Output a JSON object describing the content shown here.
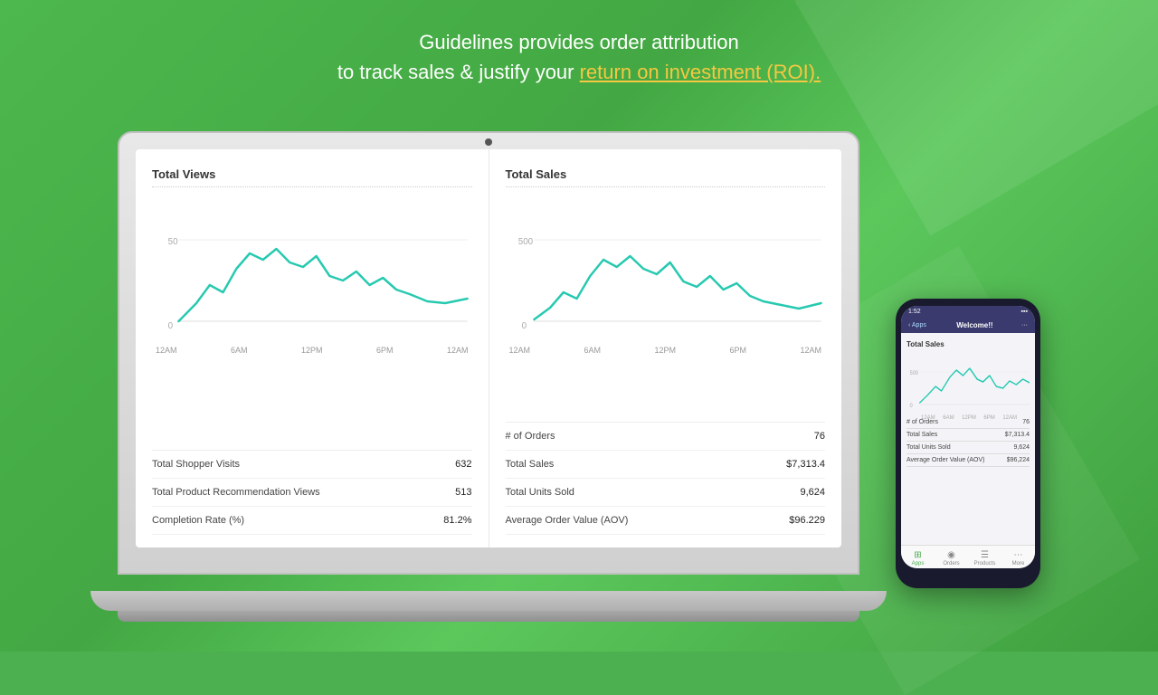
{
  "header": {
    "line1": "Guidelines provides order attribution",
    "line2_prefix": "to track sales & justify your ",
    "line2_highlight": "return on investment (ROI).",
    "line2_suffix": ""
  },
  "laptop": {
    "left_panel": {
      "title": "Total Views",
      "chart_y_label": "50",
      "chart_y_zero": "0",
      "chart_x_labels": [
        "12AM",
        "6AM",
        "12PM",
        "6PM",
        "12AM"
      ],
      "stats": [
        {
          "label": "Total Shopper Visits",
          "value": "632"
        },
        {
          "label": "Total Product Recommendation Views",
          "value": "513"
        },
        {
          "label": "Completion Rate (%)",
          "value": "81.2%"
        }
      ]
    },
    "right_panel": {
      "title": "Total Sales",
      "chart_y_label": "500",
      "chart_y_zero": "0",
      "chart_x_labels": [
        "12AM",
        "6AM",
        "12PM",
        "6PM",
        "12AM"
      ],
      "stats": [
        {
          "label": "# of Orders",
          "value": "76"
        },
        {
          "label": "Total Sales",
          "value": "$7,313.4"
        },
        {
          "label": "Total Units Sold",
          "value": "9,624"
        },
        {
          "label": "Average Order Value (AOV)",
          "value": "$96.229"
        }
      ]
    }
  },
  "phone": {
    "time": "1:52",
    "nav_back": "< Apps",
    "nav_title": "Welcome!!",
    "nav_menu": "···",
    "tabs": [
      "Apps",
      "Orders",
      "Products",
      "More"
    ],
    "active_tab": "Welcome!!",
    "section_title": "Total Sales",
    "stats": [
      {
        "label": "# of Orders",
        "value": "76"
      },
      {
        "label": "Total Sales",
        "value": "$7,313.4"
      },
      {
        "label": "Total Units Sold",
        "value": "9,624"
      },
      {
        "label": "Average Order Value (AOV)",
        "value": "$96,224"
      }
    ],
    "bottom_nav": [
      "Apps",
      "Orders",
      "Products",
      "More"
    ]
  }
}
